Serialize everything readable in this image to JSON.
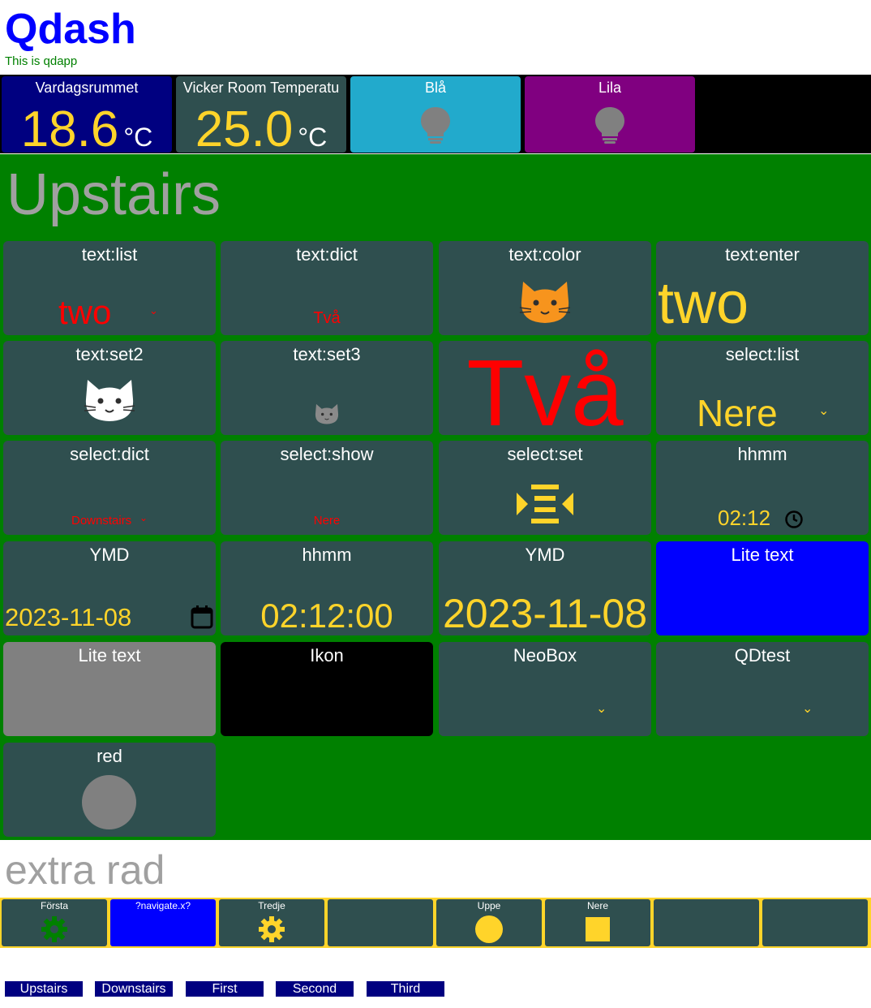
{
  "app": {
    "title": "Qdash",
    "subtitle": "This is qdapp"
  },
  "colors": {
    "accent_yellow": "#ffd42a",
    "tile_bg": "#2f4f4f",
    "page_green": "#008000",
    "nav_blue": "#000080"
  },
  "topbar": {
    "tiles": [
      {
        "title": "Vardagsrummet",
        "value": "18.6",
        "unit": "°C"
      },
      {
        "title": "Vicker Room Temperatu",
        "value": "25.0",
        "unit": "°C"
      },
      {
        "title": "Blå",
        "icon": "lightbulb-icon"
      },
      {
        "title": "Lila",
        "icon": "lightbulb-icon"
      }
    ]
  },
  "upstairs": {
    "title": "Upstairs",
    "tiles": {
      "text_list": {
        "title": "text:list",
        "value": "two"
      },
      "text_dict": {
        "title": "text:dict",
        "value": "Två"
      },
      "text_color": {
        "title": "text:color",
        "icon": "cat-face-icon"
      },
      "text_enter": {
        "title": "text:enter",
        "value": "two"
      },
      "text_set2": {
        "title": "text:set2",
        "icon": "cat-face-icon"
      },
      "text_set3": {
        "title": "text:set3",
        "icon": "cat-face-icon"
      },
      "big_text": {
        "value": "Två"
      },
      "select_list": {
        "title": "select:list",
        "value": "Nere"
      },
      "select_dict": {
        "title": "select:dict",
        "value": "Downstairs"
      },
      "select_show": {
        "title": "select:show",
        "value": "Nere"
      },
      "select_set": {
        "title": "select:set",
        "icon": "align-center-icon"
      },
      "hhmm1": {
        "title": "hhmm",
        "value": "02:12"
      },
      "ymd1": {
        "title": "YMD",
        "value": "2023-11-08"
      },
      "hhmm2": {
        "title": "hhmm",
        "value": "02:12:00"
      },
      "ymd2": {
        "title": "YMD",
        "value": "2023-11-08"
      },
      "lite_text_blue": {
        "title": "Lite text"
      },
      "lite_text_gray": {
        "title": "Lite text"
      },
      "ikon": {
        "title": "Ikon"
      },
      "neobox": {
        "title": "NeoBox"
      },
      "qdtest": {
        "title": "QDtest"
      },
      "red": {
        "title": "red"
      }
    }
  },
  "extra": {
    "title": "extra rad",
    "buttons": [
      {
        "label": "Första",
        "icon": "gear-icon"
      },
      {
        "label": "?navigate.x?"
      },
      {
        "label": "Tredje",
        "icon": "gear-icon"
      },
      {
        "label": ""
      },
      {
        "label": "Uppe",
        "icon": "circle-icon"
      },
      {
        "label": "Nere",
        "icon": "square-icon"
      },
      {
        "label": ""
      },
      {
        "label": ""
      }
    ]
  },
  "nav": {
    "links": [
      "Upstairs",
      "Downstairs",
      "First",
      "Second",
      "Third"
    ]
  }
}
